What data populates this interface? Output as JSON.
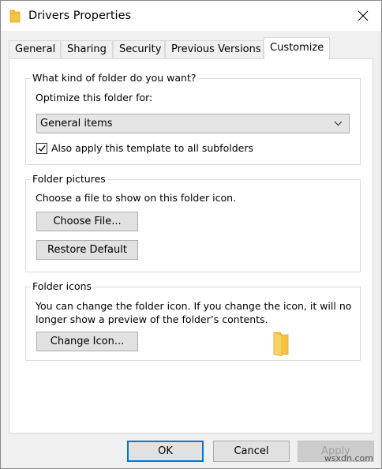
{
  "window": {
    "title": "Drivers Properties"
  },
  "tabs": [
    {
      "label": "General"
    },
    {
      "label": "Sharing"
    },
    {
      "label": "Security"
    },
    {
      "label": "Previous Versions"
    },
    {
      "label": "Customize",
      "active": true
    }
  ],
  "folder_type": {
    "group_label": "What kind of folder do you want?",
    "optimize_label": "Optimize this folder for:",
    "selected_option": "General items",
    "apply_checkbox_label": "Also apply this template to all subfolders",
    "apply_checked": true
  },
  "folder_pictures": {
    "group_label": "Folder pictures",
    "description": "Choose a file to show on this folder icon.",
    "choose_file_label": "Choose File...",
    "restore_default_label": "Restore Default"
  },
  "folder_icons": {
    "group_label": "Folder icons",
    "description_line1": "You can change the folder icon. If you change the icon, it will no",
    "description_line2": "longer show a preview of the folder’s contents.",
    "change_icon_label": "Change Icon..."
  },
  "footer": {
    "ok_label": "OK",
    "cancel_label": "Cancel",
    "apply_label": "Apply",
    "watermark": "wsxdn.com"
  },
  "colors": {
    "accent": "#0078d7",
    "folder_yellow": "#f5c542"
  },
  "icons": [
    "folder-icon",
    "close-icon",
    "chevron-down-icon",
    "checkmark-icon"
  ]
}
